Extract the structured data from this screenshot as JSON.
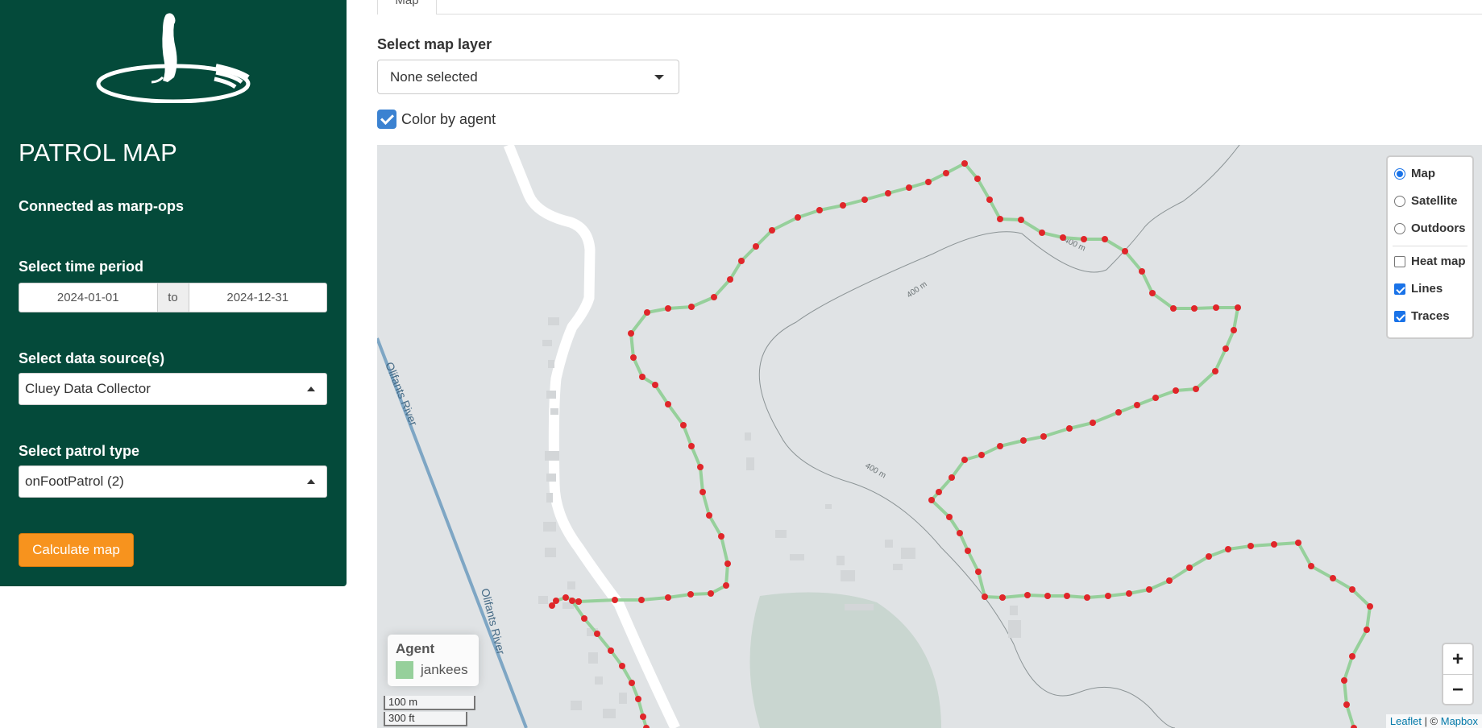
{
  "sidebar": {
    "title": "PATROL MAP",
    "connected_text": "Connected as marp-ops",
    "time_period_label": "Select time period",
    "date_start": "2024-01-01",
    "date_sep": "to",
    "date_end": "2024-12-31",
    "data_source_label": "Select data source(s)",
    "data_source_value": "Cluey Data Collector",
    "patrol_type_label": "Select patrol type",
    "patrol_type_value": "onFootPatrol (2)",
    "calculate_label": "Calculate map"
  },
  "main": {
    "tab_label": "Map",
    "layer_label": "Select map layer",
    "layer_value": "None selected",
    "color_by_agent_label": "Color by agent",
    "color_by_agent_checked": true
  },
  "map": {
    "layers": {
      "base": [
        {
          "label": "Map",
          "selected": true
        },
        {
          "label": "Satellite",
          "selected": false
        },
        {
          "label": "Outdoors",
          "selected": false
        }
      ],
      "overlays": [
        {
          "label": "Heat map",
          "checked": false
        },
        {
          "label": "Lines",
          "checked": true
        },
        {
          "label": "Traces",
          "checked": true
        }
      ]
    },
    "legend": {
      "title": "Agent",
      "items": [
        {
          "label": "jankees",
          "color": "#96d09b"
        }
      ]
    },
    "zoom_in": "+",
    "zoom_out": "−",
    "scale_metric": "100 m",
    "scale_imperial": "300 ft",
    "attribution_leaflet": "Leaflet",
    "attribution_sep": " | © ",
    "attribution_mapbox": "Mapbox",
    "river_label": "Olifants River",
    "contour_labels": [
      "400 m",
      "400 m",
      "400 m"
    ],
    "colors": {
      "track_line": "#96d09b",
      "track_point": "#e0262a",
      "river": "#7ea6c4",
      "park": "#c9d6d0",
      "road": "#ffffff"
    }
  }
}
